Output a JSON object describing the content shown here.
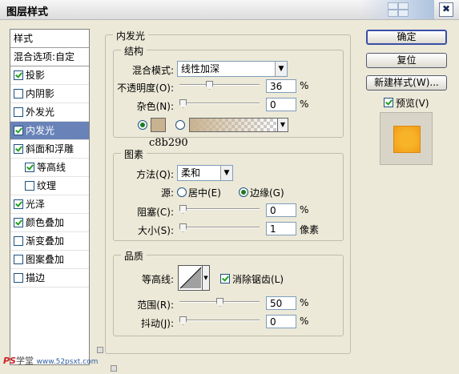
{
  "window": {
    "title": "图层样式",
    "close_icon": "✖"
  },
  "styles_list": {
    "header": "样式",
    "blend_options": "混合选项:自定",
    "items": [
      {
        "label": "投影",
        "checked": true,
        "sub": false,
        "selected": false
      },
      {
        "label": "内阴影",
        "checked": false,
        "sub": false,
        "selected": false
      },
      {
        "label": "外发光",
        "checked": false,
        "sub": false,
        "selected": false
      },
      {
        "label": "内发光",
        "checked": true,
        "sub": false,
        "selected": true
      },
      {
        "label": "斜面和浮雕",
        "checked": true,
        "sub": false,
        "selected": false
      },
      {
        "label": "等高线",
        "checked": true,
        "sub": true,
        "selected": false
      },
      {
        "label": "纹理",
        "checked": false,
        "sub": true,
        "selected": false
      },
      {
        "label": "光泽",
        "checked": true,
        "sub": false,
        "selected": false
      },
      {
        "label": "颜色叠加",
        "checked": true,
        "sub": false,
        "selected": false
      },
      {
        "label": "渐变叠加",
        "checked": false,
        "sub": false,
        "selected": false
      },
      {
        "label": "图案叠加",
        "checked": false,
        "sub": false,
        "selected": false
      },
      {
        "label": "描边",
        "checked": false,
        "sub": false,
        "selected": false
      }
    ]
  },
  "panel": {
    "title": "内发光",
    "structure": {
      "title": "结构",
      "blend_mode_label": "混合模式:",
      "blend_mode_value": "线性加深",
      "opacity_label": "不透明度(O):",
      "opacity_value": "36",
      "opacity_unit": "%",
      "opacity_level": 0.36,
      "noise_label": "杂色(N):",
      "noise_value": "0",
      "noise_unit": "%",
      "noise_level": 0.0,
      "glow_color": "#c8b290",
      "color_annotation": "c8b290"
    },
    "elements": {
      "title": "图素",
      "technique_label": "方法(Q):",
      "technique_value": "柔和",
      "source_label": "源:",
      "source_center": "居中(E)",
      "source_edge": "边缘(G)",
      "choke_label": "阻塞(C):",
      "choke_value": "0",
      "choke_unit": "%",
      "choke_level": 0.0,
      "size_label": "大小(S):",
      "size_value": "1",
      "size_unit": "像素",
      "size_level": 0.004
    },
    "quality": {
      "title": "品质",
      "contour_label": "等高线:",
      "antialias_label": "消除锯齿(L)",
      "antialias_checked": true,
      "range_label": "范围(R):",
      "range_value": "50",
      "range_unit": "%",
      "range_level": 0.5,
      "jitter_label": "抖动(J):",
      "jitter_value": "0",
      "jitter_unit": "%",
      "jitter_level": 0.0
    }
  },
  "buttons": {
    "ok": "确定",
    "reset": "复位",
    "new_style": "新建样式(W)...",
    "preview_label": "预览(V)",
    "preview_checked": true
  },
  "watermark": {
    "ps": "PS",
    "text": "学堂",
    "url": "www.52psxt.com"
  }
}
